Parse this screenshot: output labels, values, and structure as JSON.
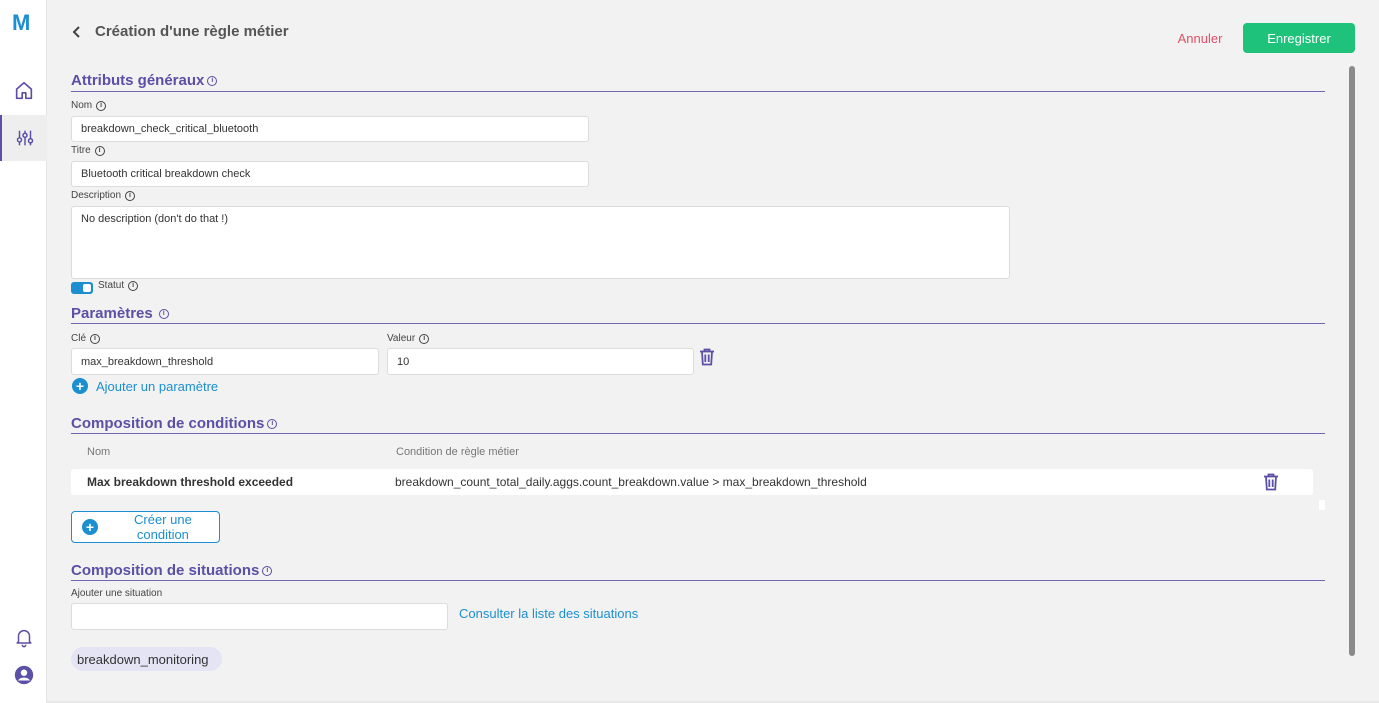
{
  "app": {
    "logo": "M"
  },
  "header": {
    "title": "Création d'une règle métier",
    "cancel_label": "Annuler",
    "save_label": "Enregistrer"
  },
  "general": {
    "section_title": "Attributs généraux",
    "name_label": "Nom",
    "name_value": "breakdown_check_critical_bluetooth",
    "title_label": "Titre",
    "title_value": "Bluetooth critical breakdown check",
    "description_label": "Description",
    "description_value": "No description (don't do that !)",
    "status_label": "Statut",
    "status_on": true
  },
  "parameters": {
    "section_title": "Paramètres",
    "key_label": "Clé",
    "value_label": "Valeur",
    "rows": [
      {
        "key": "max_breakdown_threshold",
        "value": "10"
      }
    ],
    "add_label": "Ajouter un paramètre"
  },
  "conditions": {
    "section_title": "Composition de conditions",
    "col_name": "Nom",
    "col_condition": "Condition de règle métier",
    "rows": [
      {
        "name": "Max breakdown threshold exceeded",
        "expression": "breakdown_count_total_daily.aggs.count_breakdown.value > max_breakdown_threshold"
      }
    ],
    "create_label": "Créer une condition"
  },
  "situations": {
    "section_title": "Composition de situations",
    "add_label": "Ajouter une situation",
    "add_value": "",
    "consult_label": "Consulter la liste des situations",
    "chips": [
      "breakdown_monitoring"
    ]
  },
  "colors": {
    "accent": "#5b4fa6",
    "primary": "#1b8fd0",
    "save": "#1fc27a",
    "cancel": "#e05068"
  },
  "info_glyph": "i"
}
